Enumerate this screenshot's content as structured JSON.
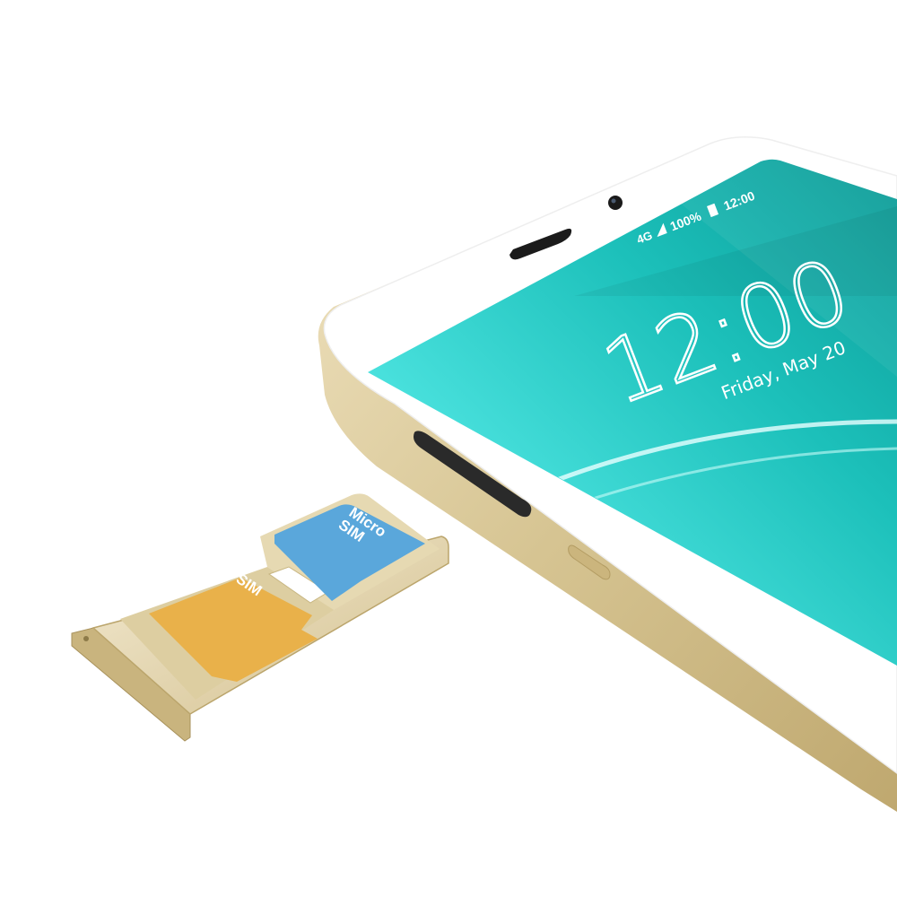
{
  "phone": {
    "status_bar": {
      "network": "4G",
      "battery_percent": "100%",
      "time": "12:00"
    },
    "lock_screen": {
      "clock": "12:00",
      "date": "Friday, May 20"
    }
  },
  "sim_tray": {
    "sim_label": "SIM",
    "micro_sim_line1": "Micro",
    "micro_sim_line2": "SIM"
  },
  "colors": {
    "screen_dark": "#0fa9a3",
    "screen_light": "#4fe3df",
    "frame_white": "#ffffff",
    "gold_frame": "#d8c79a",
    "sim_yellow": "#e9b14a",
    "micro_sim_blue": "#5aa7db"
  }
}
